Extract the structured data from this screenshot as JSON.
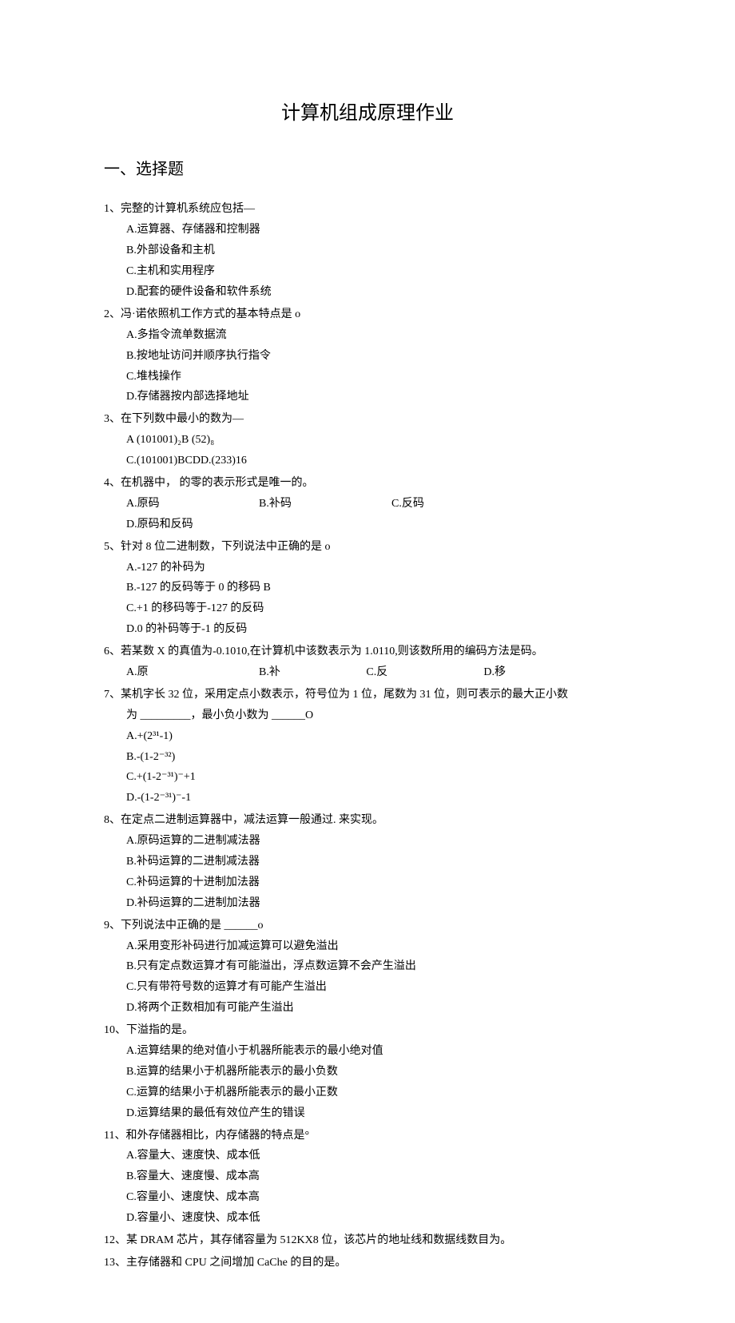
{
  "title": "计算机组成原理作业",
  "section1_title": "一、选择题",
  "q1": {
    "stem": "1、完整的计算机系统应包括—",
    "a": "A.运算器、存储器和控制器",
    "b": "B.外部设备和主机",
    "c": "C.主机和实用程序",
    "d": "D.配套的硬件设备和软件系统"
  },
  "q2": {
    "stem": "2、冯·诺依照机工作方式的基本特点是 o",
    "a": "A.多指令流单数据流",
    "b": "B.按地址访问并顺序执行指令",
    "c": "C.堆栈操作",
    "d": "D.存储器按内部选择地址"
  },
  "q3": {
    "stem": "3、在下列数中最小的数为—",
    "ab": "A  (101001)₂B  (52)₈",
    "cd": "C.(101001)BCDD.(233)16"
  },
  "q4": {
    "stem": "4、在机器中，       的零的表示形式是唯一的。",
    "a": "A.原码",
    "b": "B.补码",
    "c": "C.反码",
    "d": "D.原码和反码"
  },
  "q5": {
    "stem": "5、针对 8 位二进制数，下列说法中正确的是 o",
    "a": "A.-127 的补码为",
    "b": "B.-127 的反码等于 0 的移码 B",
    "c": "C.+1 的移码等于-127 的反码",
    "d": "D.0 的补码等于-1 的反码"
  },
  "q6": {
    "stem": "6、若某数 X 的真值为-0.1010,在计算机中该数表示为 1.0110,则该数所用的编码方法是码。",
    "a": "A.原",
    "b": "B.补",
    "c": "C.反",
    "d": "D.移"
  },
  "q7": {
    "stem": "7、某机字长 32 位，采用定点小数表示，符号位为 1 位，尾数为 31 位，则可表示的最大正小数",
    "stem2": "为 _________，最小负小数为 ______O",
    "a": "A.+(2³¹-1)",
    "b": "B.-(1-2⁻³²)",
    "c": "C.+(1-2⁻³¹)⁻+1",
    "d": "D.-(1-2⁻³¹)⁻-1"
  },
  "q8": {
    "stem": "8、在定点二进制运算器中，减法运算一般通过.       来实现。",
    "a": "A.原码运算的二进制减法器",
    "b": "B.补码运算的二进制减法器",
    "c": "C.补码运算的十进制加法器",
    "d": "D.补码运算的二进制加法器"
  },
  "q9": {
    "stem": "9、下列说法中正确的是 ______o",
    "a": "A.采用变形补码进行加减运算可以避免溢出",
    "b": "B.只有定点数运算才有可能溢出，浮点数运算不会产生溢出",
    "c": "C.只有带符号数的运算才有可能产生溢出",
    "d": "D.将两个正数相加有可能产生溢出"
  },
  "q10": {
    "stem": "10、下溢指的是。",
    "a": "A.运算结果的绝对值小于机器所能表示的最小绝对值",
    "b": "B.运算的结果小于机器所能表示的最小负数",
    "c": "C.运算的结果小于机器所能表示的最小正数",
    "d": "D.运算结果的最低有效位产生的错误"
  },
  "q11": {
    "stem": "11、和外存储器相比，内存储器的特点是°",
    "a": "A.容量大、速度快、成本低",
    "b": "B.容量大、速度慢、成本高",
    "c": "C.容量小、速度快、成本高",
    "d": "D.容量小、速度快、成本低"
  },
  "q12": {
    "stem": "12、某 DRAM 芯片，其存储容量为 512KX8 位，该芯片的地址线和数据线数目为。"
  },
  "q13": {
    "stem": "13、主存储器和 CPU 之间增加 CaChe 的目的是。"
  }
}
